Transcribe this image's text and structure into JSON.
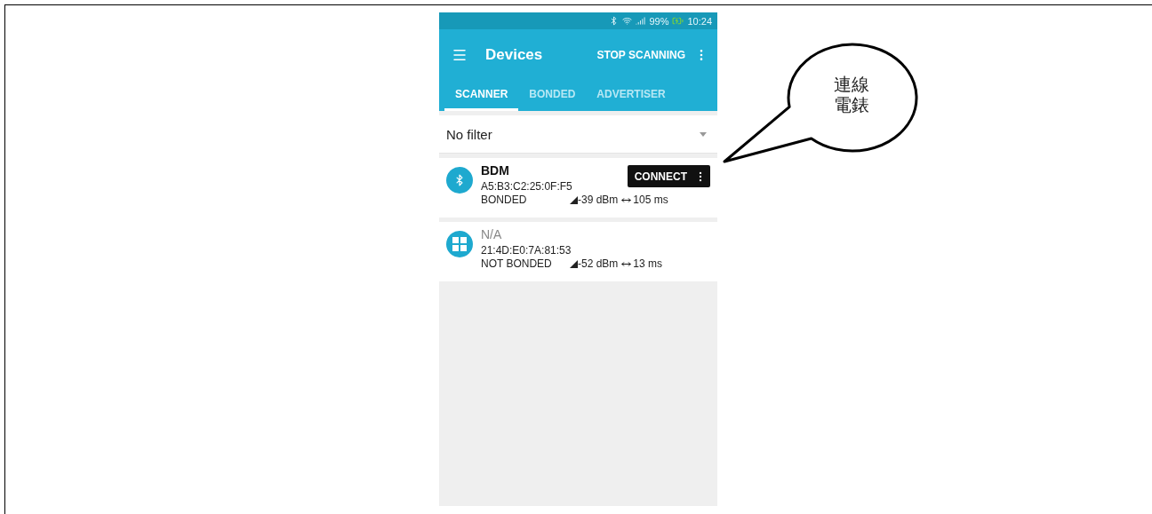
{
  "status_bar": {
    "battery": "99%",
    "time": "10:24"
  },
  "app_bar": {
    "title": "Devices",
    "action": "STOP SCANNING"
  },
  "tabs": [
    {
      "label": "SCANNER",
      "selected": true
    },
    {
      "label": "BONDED",
      "selected": false
    },
    {
      "label": "ADVERTISER",
      "selected": false
    }
  ],
  "filter": {
    "value": "No filter"
  },
  "devices": [
    {
      "kind": "bluetooth",
      "name": "BDM",
      "address": "A5:B3:C2:25:0F:F5",
      "bond": "BONDED",
      "rssi": "-39 dBm",
      "interval": "105 ms",
      "action": "CONNECT"
    },
    {
      "kind": "unknown",
      "name": "N/A",
      "address": "21:4D:E0:7A:81:53",
      "bond": "NOT BONDED",
      "rssi": "-52 dBm",
      "interval": "13 ms"
    }
  ],
  "callout": {
    "text": "連線電錶"
  }
}
